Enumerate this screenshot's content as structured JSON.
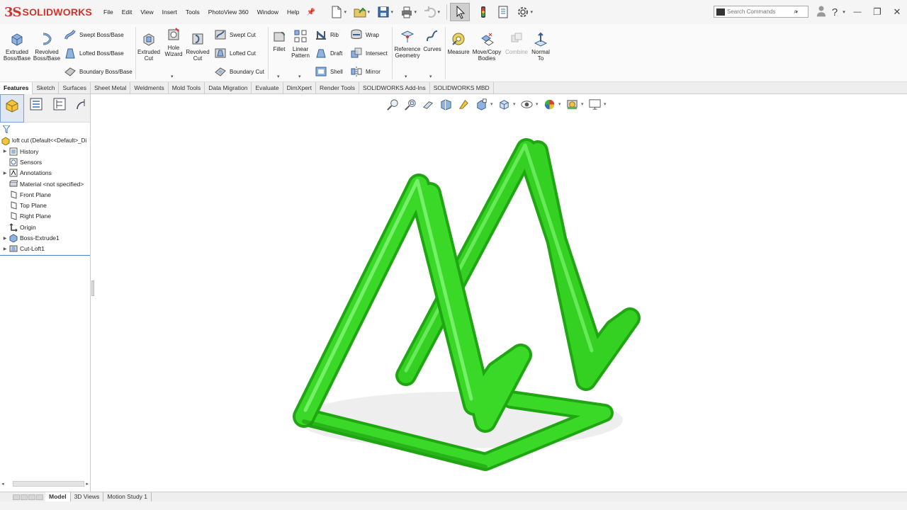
{
  "app": {
    "brand_prefix": "3S",
    "brand_name": "SOLIDWORKS"
  },
  "menu": [
    "File",
    "Edit",
    "View",
    "Insert",
    "Tools",
    "PhotoView 360",
    "Window",
    "Help"
  ],
  "search": {
    "placeholder": "Search Commands"
  },
  "window_controls": {
    "help": "?",
    "minimize": "—",
    "restore": "❐",
    "close": "✕"
  },
  "ribbon": {
    "extruded_boss": "Extruded Boss/Base",
    "revolved_boss": "Revolved Boss/Base",
    "swept_boss": "Swept Boss/Base",
    "lofted_boss": "Lofted Boss/Base",
    "boundary_boss": "Boundary Boss/Base",
    "extruded_cut": "Extruded Cut",
    "hole_wizard": "Hole Wizard",
    "revolved_cut": "Revolved Cut",
    "swept_cut": "Swept Cut",
    "lofted_cut": "Lofted Cut",
    "boundary_cut": "Boundary Cut",
    "fillet": "Fillet",
    "linear_pattern": "Linear Pattern",
    "rib": "Rib",
    "wrap": "Wrap",
    "draft": "Draft",
    "intersect": "Intersect",
    "shell": "Shell",
    "mirror": "Mirror",
    "reference_geometry": "Reference Geometry",
    "curves": "Curves",
    "measure": "Measure",
    "move_copy_bodies": "Move/Copy Bodies",
    "combine": "Combine",
    "normal_to": "Normal To"
  },
  "tabs": [
    "Features",
    "Sketch",
    "Surfaces",
    "Sheet Metal",
    "Weldments",
    "Mold Tools",
    "Data Migration",
    "Evaluate",
    "DimXpert",
    "Render Tools",
    "SOLIDWORKS Add-Ins",
    "SOLIDWORKS MBD"
  ],
  "feature_tree": {
    "root": "loft cut  (Default<<Default>_Di",
    "items": [
      {
        "label": "History",
        "expandable": true
      },
      {
        "label": "Sensors",
        "expandable": false
      },
      {
        "label": "Annotations",
        "expandable": true
      },
      {
        "label": "Material <not specified>",
        "expandable": false
      },
      {
        "label": "Front Plane",
        "expandable": false
      },
      {
        "label": "Top Plane",
        "expandable": false
      },
      {
        "label": "Right Plane",
        "expandable": false
      },
      {
        "label": "Origin",
        "expandable": false
      },
      {
        "label": "Boss-Extrude1",
        "expandable": true
      },
      {
        "label": "Cut-Loft1",
        "expandable": true
      }
    ]
  },
  "bottom_tabs": [
    "Model",
    "3D Views",
    "Motion Study 1"
  ],
  "colors": {
    "model_green": "#2ecc1f",
    "brand_red": "#d4322c",
    "accent_blue": "#3a7ecb"
  }
}
